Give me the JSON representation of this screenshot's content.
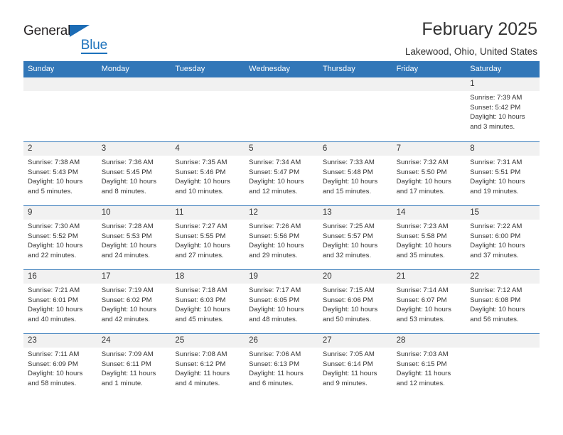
{
  "brand": {
    "name_top": "General",
    "name_bottom": "Blue",
    "triangle_color": "#1c6cb5",
    "blue_color": "#1c72bc",
    "dark_color": "#231f20"
  },
  "header": {
    "title": "February 2025",
    "subtitle": "Lakewood, Ohio, United States"
  },
  "theme": {
    "header_band": "#3277b8",
    "day_number_band": "#f1f1f1",
    "text": "#333333",
    "row_divider": "#3277b8"
  },
  "weekdays": [
    "Sunday",
    "Monday",
    "Tuesday",
    "Wednesday",
    "Thursday",
    "Friday",
    "Saturday"
  ],
  "labels": {
    "sunrise": "Sunrise:",
    "sunset": "Sunset:",
    "daylight": "Daylight:"
  },
  "weeks": [
    [
      {
        "day": "",
        "sunrise": "",
        "sunset": "",
        "daylight": ""
      },
      {
        "day": "",
        "sunrise": "",
        "sunset": "",
        "daylight": ""
      },
      {
        "day": "",
        "sunrise": "",
        "sunset": "",
        "daylight": ""
      },
      {
        "day": "",
        "sunrise": "",
        "sunset": "",
        "daylight": ""
      },
      {
        "day": "",
        "sunrise": "",
        "sunset": "",
        "daylight": ""
      },
      {
        "day": "",
        "sunrise": "",
        "sunset": "",
        "daylight": ""
      },
      {
        "day": "1",
        "sunrise": "Sunrise: 7:39 AM",
        "sunset": "Sunset: 5:42 PM",
        "daylight": "Daylight: 10 hours and 3 minutes."
      }
    ],
    [
      {
        "day": "2",
        "sunrise": "Sunrise: 7:38 AM",
        "sunset": "Sunset: 5:43 PM",
        "daylight": "Daylight: 10 hours and 5 minutes."
      },
      {
        "day": "3",
        "sunrise": "Sunrise: 7:36 AM",
        "sunset": "Sunset: 5:45 PM",
        "daylight": "Daylight: 10 hours and 8 minutes."
      },
      {
        "day": "4",
        "sunrise": "Sunrise: 7:35 AM",
        "sunset": "Sunset: 5:46 PM",
        "daylight": "Daylight: 10 hours and 10 minutes."
      },
      {
        "day": "5",
        "sunrise": "Sunrise: 7:34 AM",
        "sunset": "Sunset: 5:47 PM",
        "daylight": "Daylight: 10 hours and 12 minutes."
      },
      {
        "day": "6",
        "sunrise": "Sunrise: 7:33 AM",
        "sunset": "Sunset: 5:48 PM",
        "daylight": "Daylight: 10 hours and 15 minutes."
      },
      {
        "day": "7",
        "sunrise": "Sunrise: 7:32 AM",
        "sunset": "Sunset: 5:50 PM",
        "daylight": "Daylight: 10 hours and 17 minutes."
      },
      {
        "day": "8",
        "sunrise": "Sunrise: 7:31 AM",
        "sunset": "Sunset: 5:51 PM",
        "daylight": "Daylight: 10 hours and 19 minutes."
      }
    ],
    [
      {
        "day": "9",
        "sunrise": "Sunrise: 7:30 AM",
        "sunset": "Sunset: 5:52 PM",
        "daylight": "Daylight: 10 hours and 22 minutes."
      },
      {
        "day": "10",
        "sunrise": "Sunrise: 7:28 AM",
        "sunset": "Sunset: 5:53 PM",
        "daylight": "Daylight: 10 hours and 24 minutes."
      },
      {
        "day": "11",
        "sunrise": "Sunrise: 7:27 AM",
        "sunset": "Sunset: 5:55 PM",
        "daylight": "Daylight: 10 hours and 27 minutes."
      },
      {
        "day": "12",
        "sunrise": "Sunrise: 7:26 AM",
        "sunset": "Sunset: 5:56 PM",
        "daylight": "Daylight: 10 hours and 29 minutes."
      },
      {
        "day": "13",
        "sunrise": "Sunrise: 7:25 AM",
        "sunset": "Sunset: 5:57 PM",
        "daylight": "Daylight: 10 hours and 32 minutes."
      },
      {
        "day": "14",
        "sunrise": "Sunrise: 7:23 AM",
        "sunset": "Sunset: 5:58 PM",
        "daylight": "Daylight: 10 hours and 35 minutes."
      },
      {
        "day": "15",
        "sunrise": "Sunrise: 7:22 AM",
        "sunset": "Sunset: 6:00 PM",
        "daylight": "Daylight: 10 hours and 37 minutes."
      }
    ],
    [
      {
        "day": "16",
        "sunrise": "Sunrise: 7:21 AM",
        "sunset": "Sunset: 6:01 PM",
        "daylight": "Daylight: 10 hours and 40 minutes."
      },
      {
        "day": "17",
        "sunrise": "Sunrise: 7:19 AM",
        "sunset": "Sunset: 6:02 PM",
        "daylight": "Daylight: 10 hours and 42 minutes."
      },
      {
        "day": "18",
        "sunrise": "Sunrise: 7:18 AM",
        "sunset": "Sunset: 6:03 PM",
        "daylight": "Daylight: 10 hours and 45 minutes."
      },
      {
        "day": "19",
        "sunrise": "Sunrise: 7:17 AM",
        "sunset": "Sunset: 6:05 PM",
        "daylight": "Daylight: 10 hours and 48 minutes."
      },
      {
        "day": "20",
        "sunrise": "Sunrise: 7:15 AM",
        "sunset": "Sunset: 6:06 PM",
        "daylight": "Daylight: 10 hours and 50 minutes."
      },
      {
        "day": "21",
        "sunrise": "Sunrise: 7:14 AM",
        "sunset": "Sunset: 6:07 PM",
        "daylight": "Daylight: 10 hours and 53 minutes."
      },
      {
        "day": "22",
        "sunrise": "Sunrise: 7:12 AM",
        "sunset": "Sunset: 6:08 PM",
        "daylight": "Daylight: 10 hours and 56 minutes."
      }
    ],
    [
      {
        "day": "23",
        "sunrise": "Sunrise: 7:11 AM",
        "sunset": "Sunset: 6:09 PM",
        "daylight": "Daylight: 10 hours and 58 minutes."
      },
      {
        "day": "24",
        "sunrise": "Sunrise: 7:09 AM",
        "sunset": "Sunset: 6:11 PM",
        "daylight": "Daylight: 11 hours and 1 minute."
      },
      {
        "day": "25",
        "sunrise": "Sunrise: 7:08 AM",
        "sunset": "Sunset: 6:12 PM",
        "daylight": "Daylight: 11 hours and 4 minutes."
      },
      {
        "day": "26",
        "sunrise": "Sunrise: 7:06 AM",
        "sunset": "Sunset: 6:13 PM",
        "daylight": "Daylight: 11 hours and 6 minutes."
      },
      {
        "day": "27",
        "sunrise": "Sunrise: 7:05 AM",
        "sunset": "Sunset: 6:14 PM",
        "daylight": "Daylight: 11 hours and 9 minutes."
      },
      {
        "day": "28",
        "sunrise": "Sunrise: 7:03 AM",
        "sunset": "Sunset: 6:15 PM",
        "daylight": "Daylight: 11 hours and 12 minutes."
      },
      {
        "day": "",
        "sunrise": "",
        "sunset": "",
        "daylight": ""
      }
    ]
  ]
}
